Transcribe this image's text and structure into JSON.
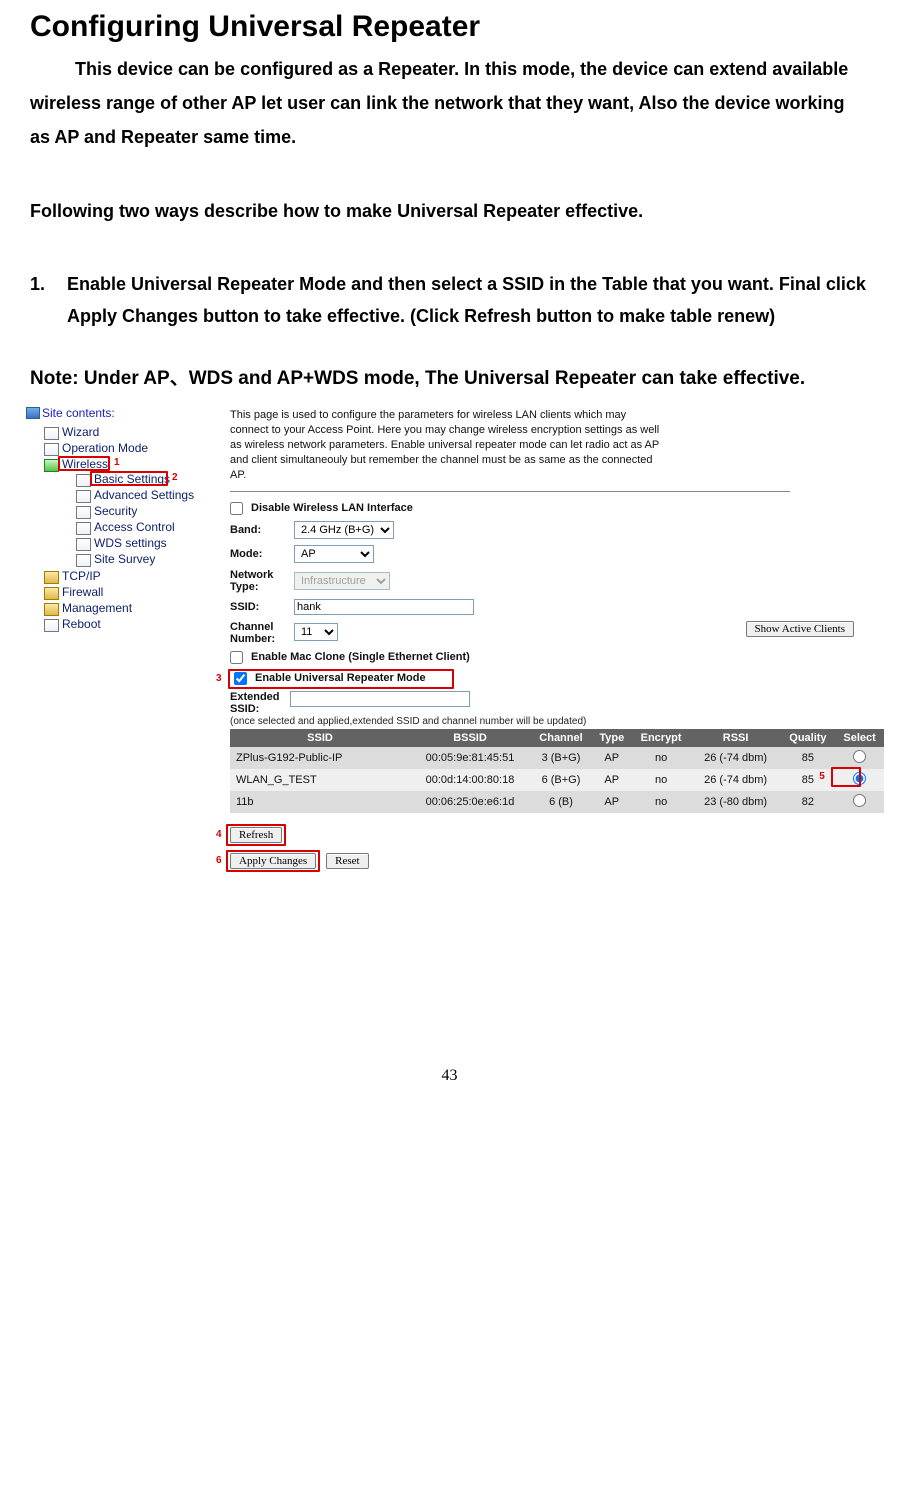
{
  "doc": {
    "heading": "Configuring Universal Repeater",
    "intro": "This device can be configured as a Repeater. In this mode, the device can extend available wireless range of other AP let user can link the network that they want, Also the device working as AP and Repeater same time.",
    "sub": "Following two ways describe how to make Universal Repeater effective.",
    "list_num": "1.",
    "list_text": "Enable Universal Repeater Mode and then select a SSID in the Table that you want. Final click Apply Changes button to take effective. (Click Refresh button to make table renew)",
    "note": "Note: Under AP、WDS and AP+WDS mode, The Universal Repeater can take effective.",
    "page_number": "43"
  },
  "sidebar": {
    "title": "Site contents:",
    "items": [
      {
        "label": "Wizard",
        "cls": "file"
      },
      {
        "label": "Operation Mode",
        "cls": "file"
      },
      {
        "label": "Wireless",
        "cls": "open"
      },
      {
        "label": "TCP/IP",
        "cls": "folder"
      },
      {
        "label": "Firewall",
        "cls": "folder"
      },
      {
        "label": "Management",
        "cls": "folder"
      },
      {
        "label": "Reboot",
        "cls": "file"
      }
    ],
    "wireless_sub": [
      "Basic Settings",
      "Advanced Settings",
      "Security",
      "Access Control",
      "WDS settings",
      "Site Survey"
    ]
  },
  "main": {
    "desc": "This page is used to configure the parameters for wireless LAN clients which may connect to your Access Point. Here you may change wireless encryption settings as well as wireless network parameters. Enable universal repeater mode can let radio act as AP and client simultaneouly but remember the channel must be as same as the connected AP.",
    "disable_lbl": "Disable Wireless LAN Interface",
    "band_lbl": "Band:",
    "band_val": "2.4 GHz (B+G)",
    "mode_lbl": "Mode:",
    "mode_val": "AP",
    "ntype_lbl": "Network Type:",
    "ntype_val": "Infrastructure",
    "ssid_lbl": "SSID:",
    "ssid_val": "hank",
    "chan_lbl": "Channel Number:",
    "chan_val": "11",
    "show_clients_btn": "Show Active Clients",
    "macclone_lbl": "Enable Mac Clone (Single Ethernet Client)",
    "urm_lbl": "Enable Universal Repeater Mode",
    "ext_lbl": "Extended SSID:",
    "ext_val": "",
    "ext_note": "(once selected and applied,extended SSID and channel number will be updated)",
    "headers": [
      "SSID",
      "BSSID",
      "Channel",
      "Type",
      "Encrypt",
      "RSSI",
      "Quality",
      "Select"
    ],
    "rows": [
      {
        "ssid": "ZPlus-G192-Public-IP",
        "bssid": "00:05:9e:81:45:51",
        "ch": "3 (B+G)",
        "type": "AP",
        "enc": "no",
        "rssi": "26 (-74 dbm)",
        "q": "85",
        "sel": false
      },
      {
        "ssid": "WLAN_G_TEST",
        "bssid": "00:0d:14:00:80:18",
        "ch": "6 (B+G)",
        "type": "AP",
        "enc": "no",
        "rssi": "26 (-74 dbm)",
        "q": "85",
        "sel": true
      },
      {
        "ssid": "11b",
        "bssid": "00:06:25:0e:e6:1d",
        "ch": "6 (B)",
        "type": "AP",
        "enc": "no",
        "rssi": "23 (-80 dbm)",
        "q": "82",
        "sel": false
      }
    ],
    "refresh_btn": "Refresh",
    "apply_btn": "Apply Changes",
    "reset_btn": "Reset"
  },
  "callouts": {
    "c1": "1",
    "c2": "2",
    "c3": "3",
    "c4": "4",
    "c5": "5",
    "c6": "6"
  }
}
